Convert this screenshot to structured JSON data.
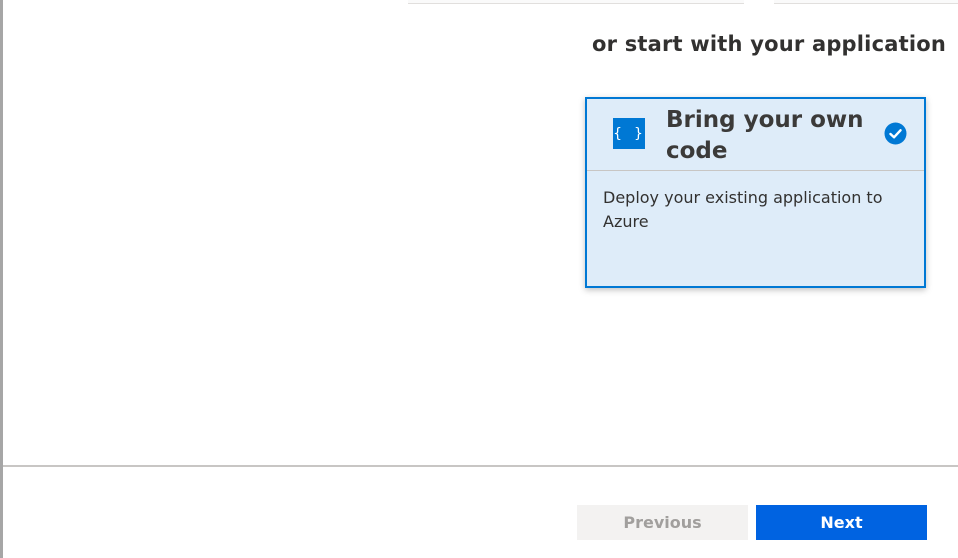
{
  "section": {
    "heading": "or start with your application"
  },
  "card": {
    "icon": "code-braces-icon",
    "icon_glyph": "{ }",
    "title": "Bring your own code",
    "description": "Deploy your existing application to Azure",
    "selected": true,
    "selected_icon": "checkmark-circle-icon"
  },
  "footer": {
    "previous_label": "Previous",
    "next_label": "Next"
  },
  "colors": {
    "accent": "#0078d4",
    "card_background": "#deecf9",
    "next_button": "#0063e1",
    "previous_button": "#f3f2f1"
  }
}
